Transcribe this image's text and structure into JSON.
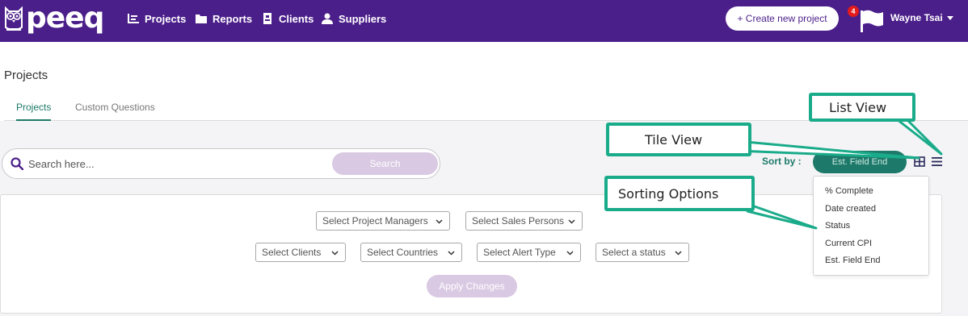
{
  "navbar": {
    "logo_text": "peeq",
    "items": [
      {
        "label": "Projects",
        "icon": "projects-icon"
      },
      {
        "label": "Reports",
        "icon": "folder-icon"
      },
      {
        "label": "Clients",
        "icon": "clients-icon"
      },
      {
        "label": "Suppliers",
        "icon": "user-icon"
      }
    ],
    "create_button": "+ Create new project",
    "notification_count": "4",
    "user_name": "Wayne Tsai"
  },
  "page": {
    "title": "Projects",
    "tabs": [
      {
        "label": "Projects",
        "active": true
      },
      {
        "label": "Custom Questions",
        "active": false
      }
    ]
  },
  "search": {
    "placeholder": "Search here...",
    "button": "Search"
  },
  "sort": {
    "label": "Sort by :",
    "selected": "Est. Field End",
    "options": [
      "% Complete",
      "Date created",
      "Status",
      "Current CPI",
      "Est. Field End"
    ]
  },
  "filters": {
    "row1": [
      "Select Project Managers",
      "Select Sales Persons"
    ],
    "row2": [
      "Select Clients",
      "Select Countries",
      "Select Alert Type",
      "Select a status"
    ],
    "apply_button": "Apply Changes"
  },
  "callouts": {
    "list_view": "List View",
    "tile_view": "Tile View",
    "sorting_options": "Sorting Options"
  },
  "colors": {
    "navbar": "#4b1f8a",
    "accent": "#1d7a6a",
    "callout_border": "#1aab8a",
    "disabled_button": "#d9c9e2",
    "badge": "#e31b1b"
  }
}
